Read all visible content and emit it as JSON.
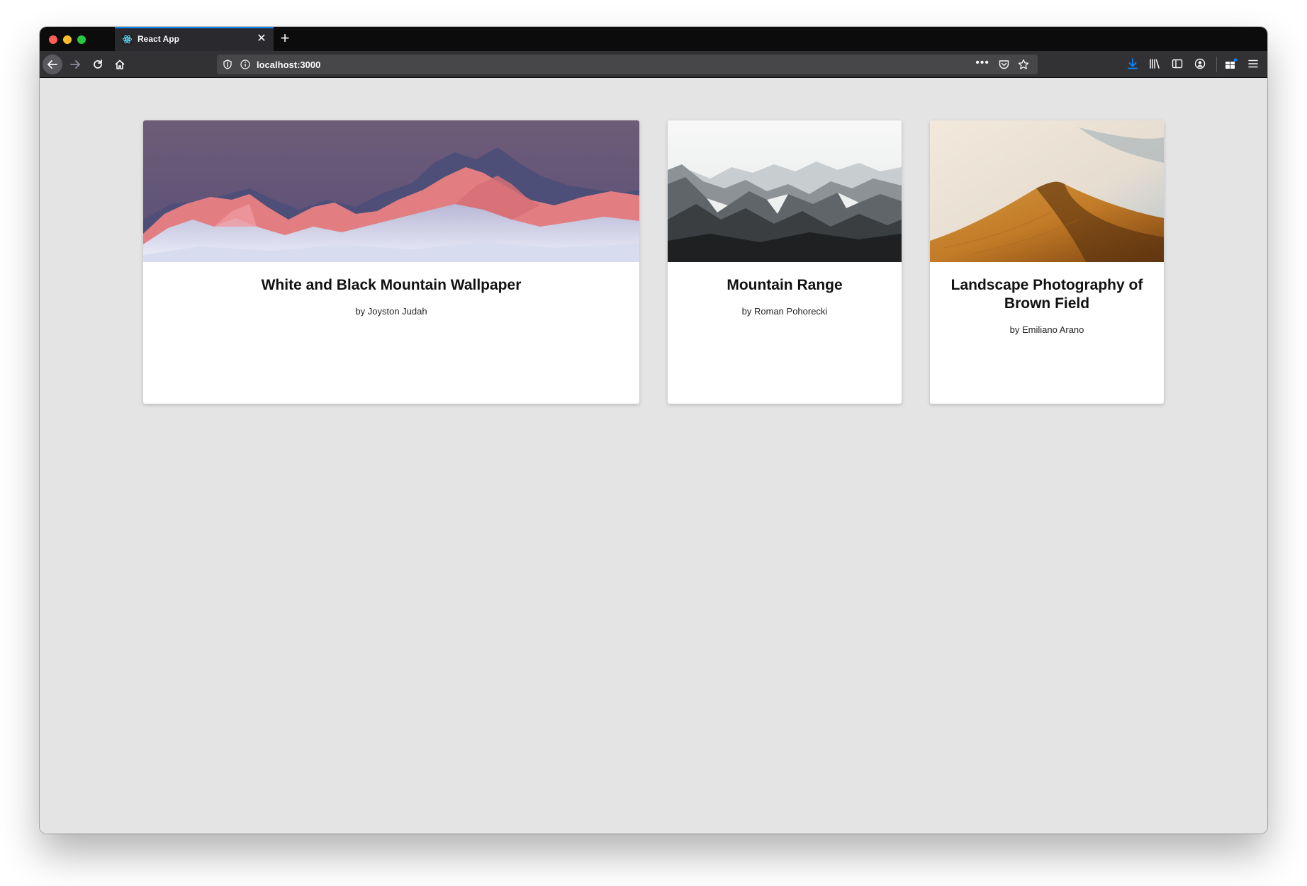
{
  "browser": {
    "tab": {
      "title": "React App",
      "favicon": "react-icon",
      "close_glyph": "✕"
    },
    "new_tab_glyph": "+",
    "url": "localhost:3000",
    "url_more_glyph": "•••",
    "accent_color": "#0a84ff"
  },
  "cards": [
    {
      "title": "White and Black Mountain Wallpaper",
      "author": "by Joyston Judah",
      "image": "pink-sunset-snowy-mountain-peaks"
    },
    {
      "title": "Mountain Range",
      "author": "by Roman Pohorecki",
      "image": "grey-rocky-mountain-range"
    },
    {
      "title": "Landscape Photography of Brown Field",
      "author": "by Emiliano Arano",
      "image": "golden-sand-dune"
    }
  ]
}
